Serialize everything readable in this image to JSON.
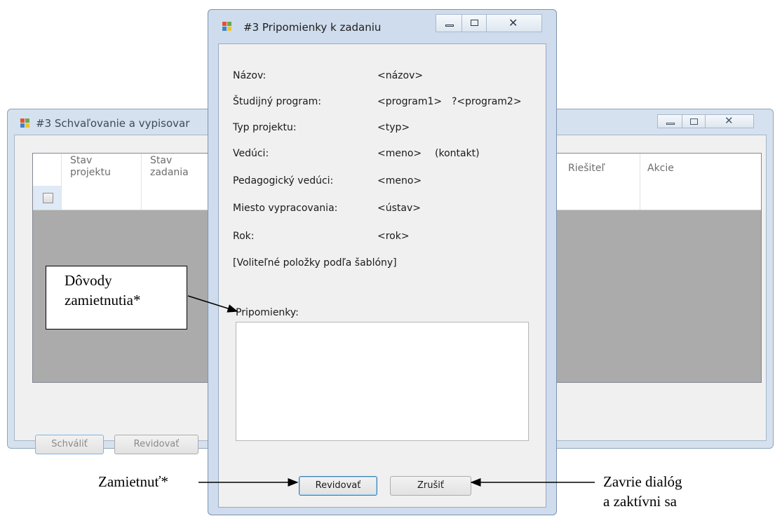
{
  "background_window": {
    "title": "#3 Schvaľovanie a vypisovar",
    "columns": [
      "Stav\nprojektu",
      "Stav\nzadania",
      "Riešiteľ",
      "Akcie"
    ],
    "buttons": {
      "approve": "Schváliť",
      "revise": "Revidovať"
    }
  },
  "dialog": {
    "title": "#3 Pripomienky k zadaniu",
    "fields": [
      {
        "label": "Názov:",
        "value": "<názov>",
        "extra": ""
      },
      {
        "label": "Študijný program:",
        "value": "<program1>",
        "extra": "?<program2>"
      },
      {
        "label": "Typ projektu:",
        "value": "<typ>",
        "extra": ""
      },
      {
        "label": "Vedúci:",
        "value": "<meno>",
        "extra": "(kontakt)"
      },
      {
        "label": "Pedagogický vedúci:",
        "value": "<meno>",
        "extra": ""
      },
      {
        "label": "Miesto vypracovania:",
        "value": "<ústav>",
        "extra": ""
      },
      {
        "label": "Rok:",
        "value": "<rok>",
        "extra": ""
      }
    ],
    "optional_note": "[Voliteľné položky podľa šablóny]",
    "comments_label": "Pripomienky:",
    "comments_value": "",
    "revise_button": "Revidovať",
    "cancel_button": "Zrušiť"
  },
  "annotations": {
    "callout": [
      "Dôvody",
      "zamietnutia*"
    ],
    "left_note": "Zamietnuť*",
    "right_note": [
      "Zavrie dialóg",
      "a zaktívni sa"
    ]
  },
  "icons": {
    "window_icon": "app-window-icon",
    "minimize": "minimize-icon",
    "maximize": "maximize-icon",
    "close": "close-icon"
  }
}
